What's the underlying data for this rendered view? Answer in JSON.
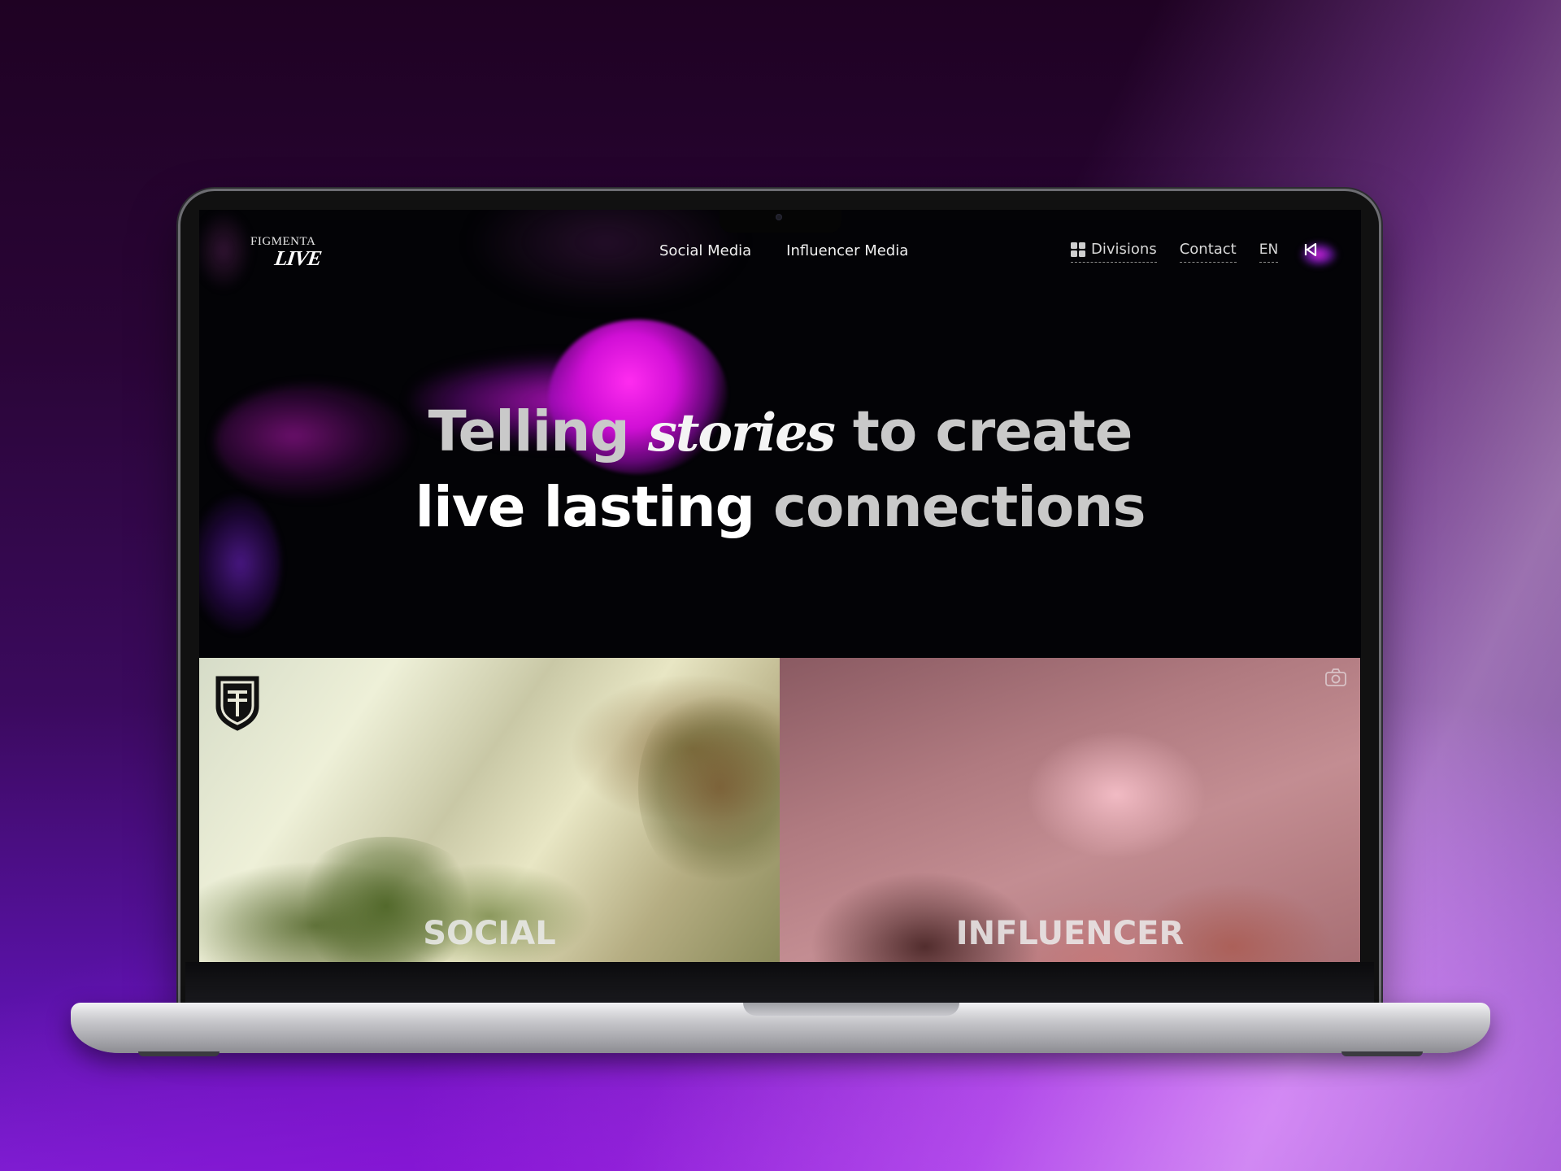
{
  "brand": {
    "logo_top": "FIGMENTA",
    "logo_bottom": "LIVE"
  },
  "nav": {
    "center": [
      {
        "label": "Social Media"
      },
      {
        "label": "Influencer Media"
      }
    ],
    "divisions_label": "Divisions",
    "contact_label": "Contact",
    "language": "EN",
    "rewind_icon": "rewind-icon"
  },
  "hero": {
    "line1_part1": "Telling",
    "line1_script": "stories",
    "line1_part2": "to create",
    "line2_part1": "live lasting",
    "line2_part2": "connections"
  },
  "panels": [
    {
      "label": "SOCIAL",
      "icon": "shield-icon"
    },
    {
      "label": "INFLUENCER",
      "icon": "camera-icon"
    }
  ],
  "colors": {
    "accent": "#e21ce8",
    "screen_bg": "#030306"
  }
}
